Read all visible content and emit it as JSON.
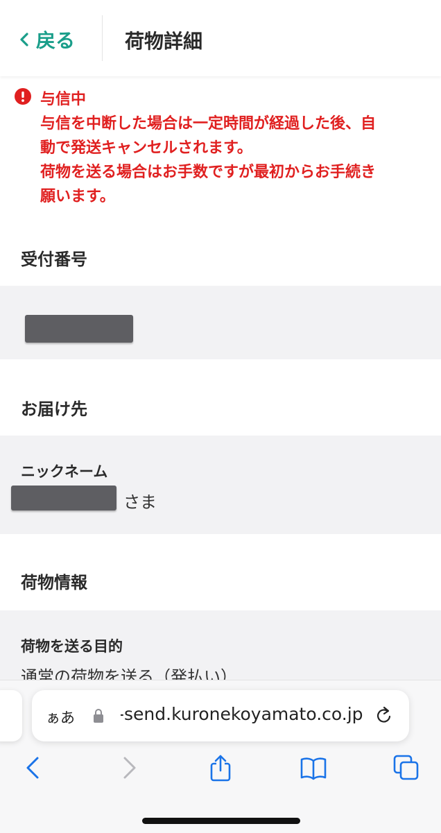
{
  "header": {
    "back_label": "戻る",
    "title": "荷物詳細"
  },
  "alert": {
    "heading": "与信中",
    "message_1": "与信を中断した場合は一定時間が経過した後、自\n動で発送キャンセルされます。",
    "message_2": "荷物を送る場合はお手数ですが最初からお手続き\n願います。",
    "color": "#e02020"
  },
  "sections": {
    "receipt": {
      "title": "受付番号"
    },
    "destination": {
      "title": "お届け先",
      "nickname_label": "ニックネーム",
      "honorific": "さま"
    },
    "package": {
      "title": "荷物情報",
      "purpose_label": "荷物を送る目的",
      "purpose_value": "通常の荷物を送る（発払い）"
    }
  },
  "browser": {
    "aa_label": "ぁあ",
    "url": "-send.kuronekoyamato.co.jp",
    "icons": [
      "lock-icon",
      "reload-icon",
      "back-arrow-icon",
      "forward-arrow-icon",
      "share-icon",
      "bookmarks-icon",
      "tabs-icon"
    ]
  },
  "colors": {
    "accent": "#1a9e8a",
    "alert": "#e02020",
    "band": "#f2f2f4",
    "browser_blue": "#1a73e8"
  }
}
